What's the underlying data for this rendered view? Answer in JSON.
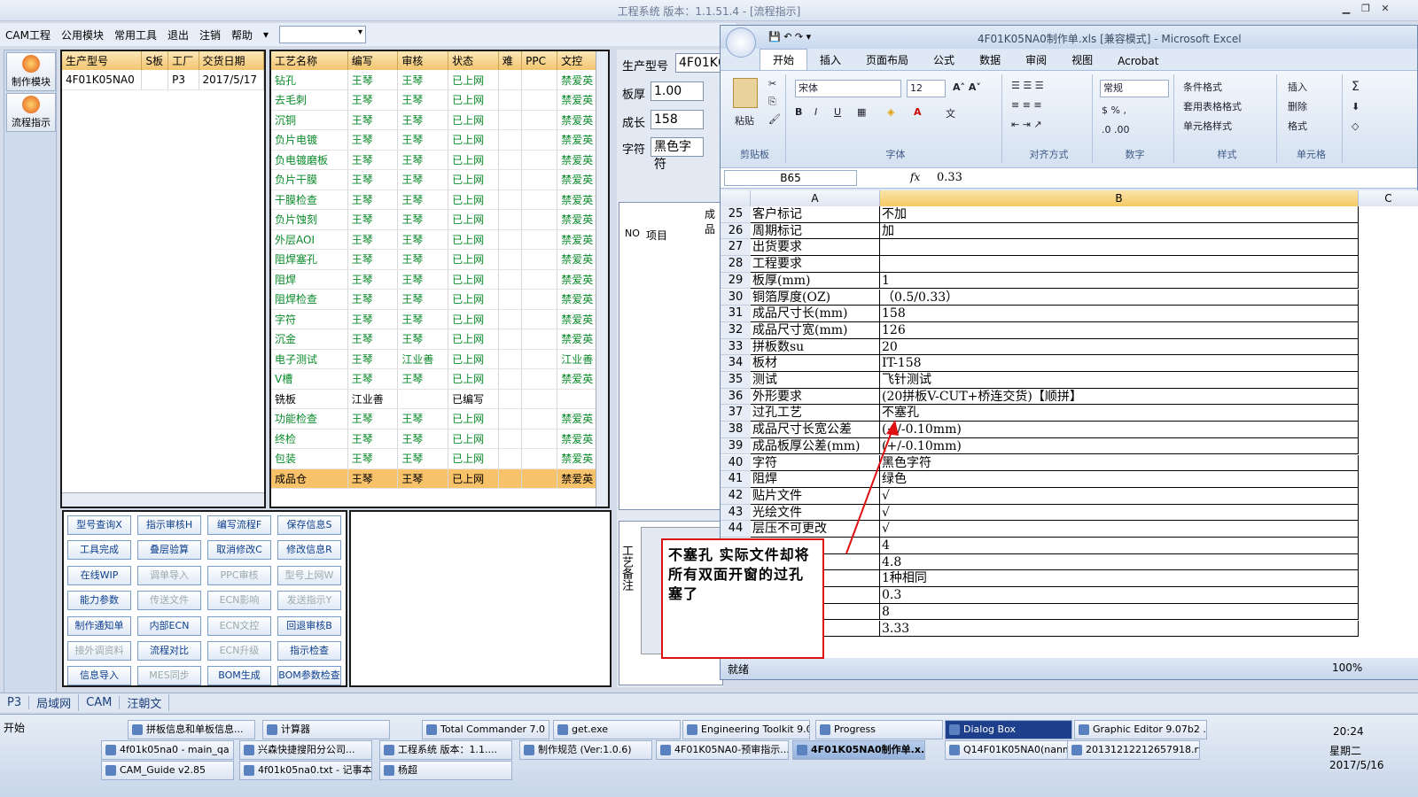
{
  "app": {
    "title": "工程系统  版本：1.1.51.4 - [流程指示]"
  },
  "menu": [
    "CAM工程",
    "公用模块",
    "常用工具",
    "退出",
    "注销",
    "帮助"
  ],
  "left_toolbar": [
    "制作模块",
    "流程指示"
  ],
  "order_grid": {
    "headers": [
      "生产型号",
      "S板",
      "工厂",
      "交货日期"
    ],
    "rows": [
      [
        "4F01K05NA0",
        "",
        "P3",
        "2017/5/17"
      ]
    ]
  },
  "process_grid": {
    "headers": [
      "工艺名称",
      "编写",
      "审核",
      "状态",
      "难",
      "PPC",
      "文控"
    ],
    "rows": [
      [
        "钻孔",
        "王琴",
        "王琴",
        "已上网",
        "",
        "",
        "禁爱英"
      ],
      [
        "去毛刺",
        "王琴",
        "王琴",
        "已上网",
        "",
        "",
        "禁爱英"
      ],
      [
        "沉铜",
        "王琴",
        "王琴",
        "已上网",
        "",
        "",
        "禁爱英"
      ],
      [
        "负片电镀",
        "王琴",
        "王琴",
        "已上网",
        "",
        "",
        "禁爱英"
      ],
      [
        "负电镀磨板",
        "王琴",
        "王琴",
        "已上网",
        "",
        "",
        "禁爱英"
      ],
      [
        "负片干膜",
        "王琴",
        "王琴",
        "已上网",
        "",
        "",
        "禁爱英"
      ],
      [
        "干膜检查",
        "王琴",
        "王琴",
        "已上网",
        "",
        "",
        "禁爱英"
      ],
      [
        "负片蚀刻",
        "王琴",
        "王琴",
        "已上网",
        "",
        "",
        "禁爱英"
      ],
      [
        "外层AOI",
        "王琴",
        "王琴",
        "已上网",
        "",
        "",
        "禁爱英"
      ],
      [
        "阻焊塞孔",
        "王琴",
        "王琴",
        "已上网",
        "",
        "",
        "禁爱英"
      ],
      [
        "阻焊",
        "王琴",
        "王琴",
        "已上网",
        "",
        "",
        "禁爱英"
      ],
      [
        "阻焊检查",
        "王琴",
        "王琴",
        "已上网",
        "",
        "",
        "禁爱英"
      ],
      [
        "字符",
        "王琴",
        "王琴",
        "已上网",
        "",
        "",
        "禁爱英"
      ],
      [
        "沉金",
        "王琴",
        "王琴",
        "已上网",
        "",
        "",
        "禁爱英"
      ],
      [
        "电子测试",
        "王琴",
        "江业善",
        "已上网",
        "",
        "",
        "江业善"
      ],
      [
        "V槽",
        "王琴",
        "王琴",
        "已上网",
        "",
        "",
        "禁爱英"
      ],
      [
        "铣板",
        "江业善",
        "",
        "已编写",
        "",
        "",
        ""
      ],
      [
        "功能检查",
        "王琴",
        "王琴",
        "已上网",
        "",
        "",
        "禁爱英"
      ],
      [
        "终检",
        "王琴",
        "王琴",
        "已上网",
        "",
        "",
        "禁爱英"
      ],
      [
        "包装",
        "王琴",
        "王琴",
        "已上网",
        "",
        "",
        "禁爱英"
      ],
      [
        "成品仓",
        "王琴",
        "王琴",
        "已上网",
        "",
        "",
        "禁爱英"
      ]
    ]
  },
  "buttons": [
    [
      "型号查询X",
      "指示审核H",
      "编写流程F",
      "保存信息S"
    ],
    [
      "工具完成",
      "叠层验算",
      "取消修改C",
      "修改信息R"
    ],
    [
      "在线WIP",
      "调单导入",
      "PPC审核",
      "型号上网W"
    ],
    [
      "能力参数",
      "传送文件",
      "ECN影响",
      "发送指示Y"
    ],
    [
      "制作通知单",
      "内部ECN",
      "ECN文控",
      "回退审核B"
    ],
    [
      "接外调资料",
      "流程对比",
      "ECN升级",
      "指示检查"
    ],
    [
      "信息导入",
      "MES同步",
      "BOM生成",
      "BOM参数检查"
    ]
  ],
  "disabled_buttons": [
    "调单导入",
    "PPC审核",
    "型号上网W",
    "传送文件",
    "ECN影响",
    "发送指示Y",
    "ECN文控",
    "接外调资料",
    "ECN升级",
    "MES同步"
  ],
  "info_panel": {
    "model_label": "生产型号",
    "model_value": "4F01K0",
    "thick_label": "板厚",
    "thick_value": "1.00",
    "len_label": "成长",
    "len_value": "158",
    "char_label": "字符",
    "char_value": "黑色字符",
    "sub_head": "成品",
    "no_label": "NO",
    "item_label": "项目",
    "remark_label": "工艺备注"
  },
  "excel": {
    "title": "4F01K05NA0制作单.xls  [兼容模式] - Microsoft Excel",
    "tabs": [
      "开始",
      "插入",
      "页面布局",
      "公式",
      "数据",
      "审阅",
      "视图",
      "Acrobat"
    ],
    "groups": [
      "剪贴板",
      "字体",
      "对齐方式",
      "数字",
      "样式",
      "单元格"
    ],
    "font_name": "宋体",
    "font_size": "12",
    "number_format": "常规",
    "paste": "粘贴",
    "style_items": [
      "条件格式",
      "套用表格格式",
      "单元格样式"
    ],
    "cell_items": [
      "插入",
      "删除",
      "格式"
    ],
    "name_box": "B65",
    "formula": "0.33",
    "fx": "fx",
    "col_A": "A",
    "col_B": "B",
    "col_C": "C",
    "rows": [
      [
        "25",
        "客户标记",
        "不加"
      ],
      [
        "26",
        "周期标记",
        "加"
      ],
      [
        "27",
        "出货要求",
        ""
      ],
      [
        "28",
        "工程要求",
        ""
      ],
      [
        "29",
        "板厚(mm)",
        "1"
      ],
      [
        "30",
        "铜箔厚度(OZ)",
        "（0.5/0.33）"
      ],
      [
        "31",
        "成品尺寸长(mm)",
        "158"
      ],
      [
        "32",
        "成品尺寸宽(mm)",
        "126"
      ],
      [
        "33",
        "拼板数su",
        "20"
      ],
      [
        "34",
        "板材",
        "IT-158"
      ],
      [
        "35",
        "测试",
        "飞针测试"
      ],
      [
        "36",
        "外形要求",
        "(20拼板V-CUT+桥连交货)【顺拼】"
      ],
      [
        "37",
        "过孔工艺",
        "不塞孔"
      ],
      [
        "38",
        "成品尺寸长宽公差",
        "(+/-0.10mm)"
      ],
      [
        "39",
        "成品板厚公差(mm)",
        "(+/-0.10mm)"
      ],
      [
        "40",
        "字符",
        "黑色字符"
      ],
      [
        "41",
        "阻焊",
        "绿色"
      ],
      [
        "42",
        "贴片文件",
        "√"
      ],
      [
        "43",
        "光绘文件",
        "√"
      ],
      [
        "44",
        "层压不可更改",
        "√"
      ],
      [
        "45",
        "",
        "4"
      ],
      [
        "46",
        "",
        "4.8"
      ],
      [
        "47",
        "",
        "1种相同"
      ],
      [
        "48",
        "",
        "0.3"
      ],
      [
        "49",
        "",
        "8"
      ],
      [
        "50",
        "",
        "3.33"
      ]
    ],
    "status": "就绪",
    "zoom": "100%"
  },
  "callout": "不塞孔 实际文件却将所有双面开窗的过孔塞了",
  "app_status": [
    "P3",
    "局域网",
    "CAM",
    "汪朝文"
  ],
  "taskbar": {
    "start": "开始",
    "row1": [
      "拼板信息和单板信息...",
      "计算器",
      "Total Commander 7.0 ...",
      "get.exe",
      "Engineering Toolkit 9.0...",
      "Progress",
      "Dialog Box",
      "Graphic Editor 9.07b2 ..."
    ],
    "row2": [
      "4f01k05na0 - main_qa",
      "兴森快捷搜阳分公司...",
      "工程系统  版本：1.1....",
      "制作规范 (Ver:1.0.6)",
      "4F01K05NA0-预审指示...",
      "4F01K05NA0制作单.x...",
      "Q14F01K05NA0(nanmin...",
      "20131212212657918.rt..."
    ],
    "row3": [
      "CAM_Guide v2.85",
      "4f01k05na0.txt - 记事本",
      "杨超"
    ],
    "time": "20:24",
    "day": "星期二",
    "date": "2017/5/16"
  }
}
